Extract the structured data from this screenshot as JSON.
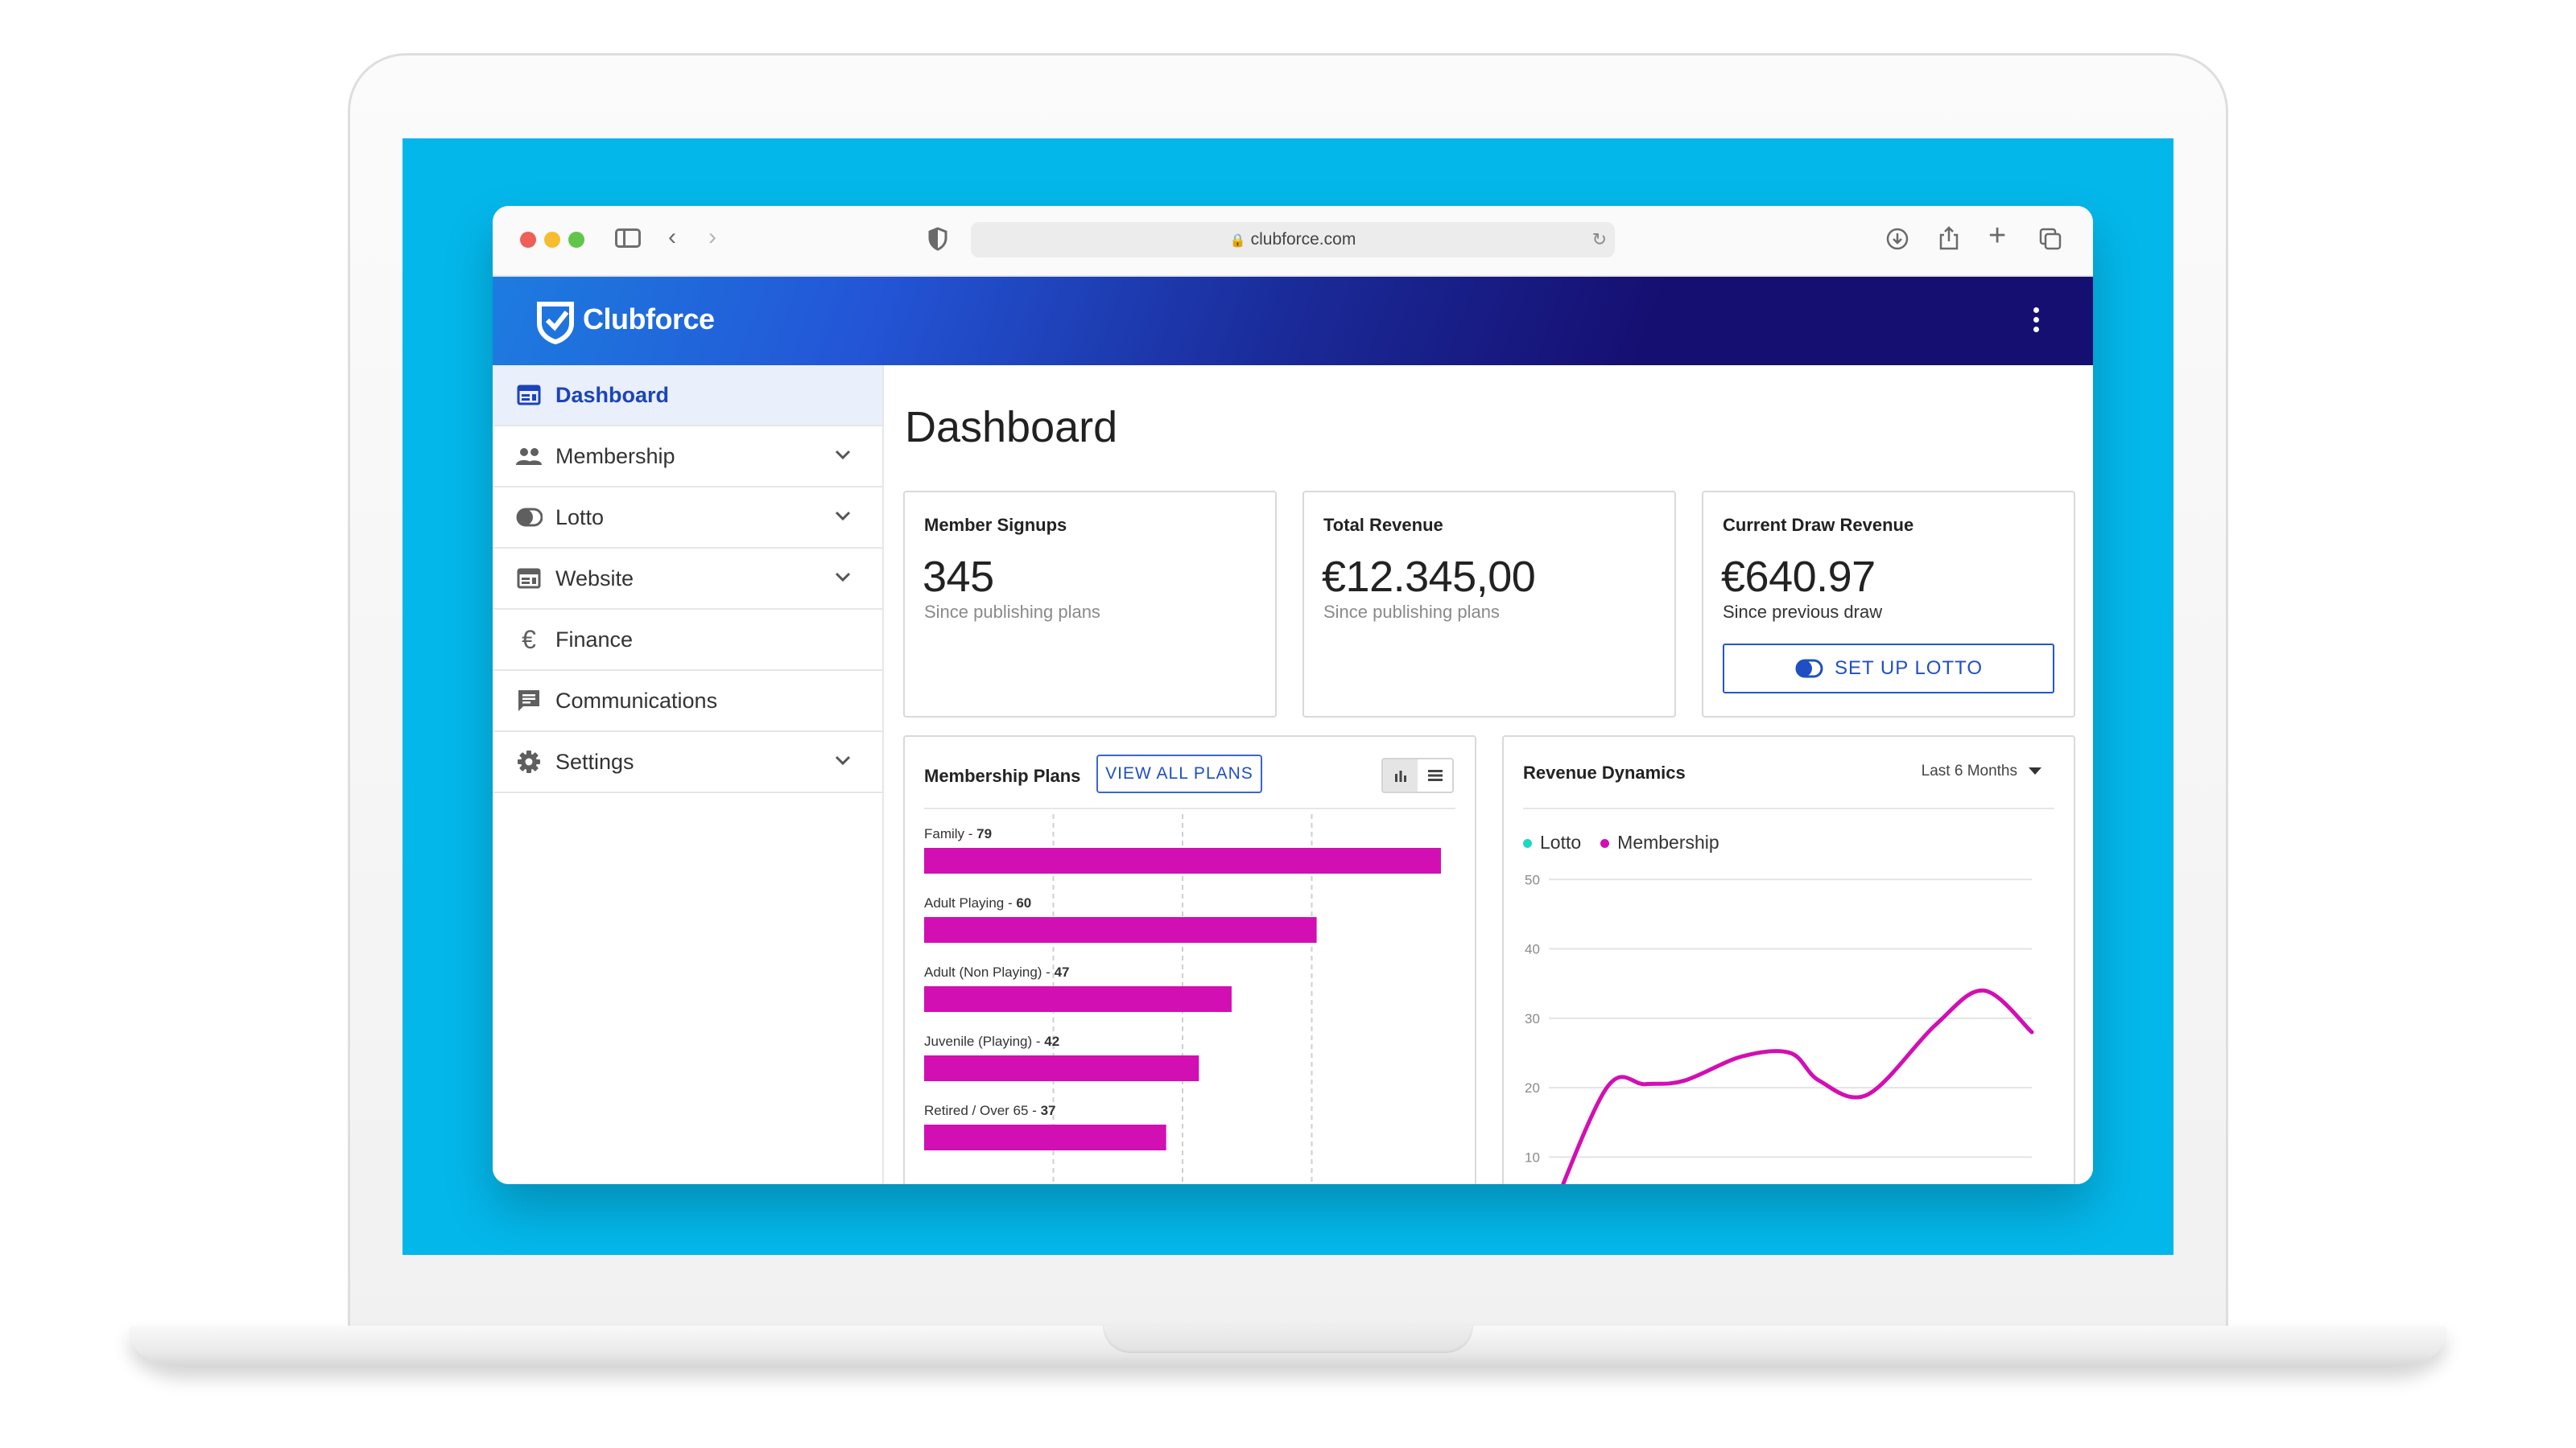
{
  "browser": {
    "url": "clubforce.com"
  },
  "app": {
    "brand": "Clubforce"
  },
  "sidebar": {
    "items": [
      {
        "label": "Dashboard",
        "icon": "dashboard-icon",
        "active": true,
        "expandable": false
      },
      {
        "label": "Membership",
        "icon": "people-icon",
        "active": false,
        "expandable": true
      },
      {
        "label": "Lotto",
        "icon": "toggle-icon",
        "active": false,
        "expandable": true
      },
      {
        "label": "Website",
        "icon": "web-icon",
        "active": false,
        "expandable": true
      },
      {
        "label": "Finance",
        "icon": "euro-icon",
        "active": false,
        "expandable": false
      },
      {
        "label": "Communications",
        "icon": "chat-icon",
        "active": false,
        "expandable": false
      },
      {
        "label": "Settings",
        "icon": "gear-icon",
        "active": false,
        "expandable": true
      }
    ]
  },
  "main": {
    "title": "Dashboard",
    "stats": [
      {
        "label": "Member Signups",
        "value": "345",
        "sub": "Since publishing plans"
      },
      {
        "label": "Total Revenue",
        "value": "€12.345,00",
        "sub": "Since publishing plans"
      },
      {
        "label": "Current Draw Revenue",
        "value": "€640.97",
        "sub": "Since previous draw",
        "button": "SET UP LOTTO"
      }
    ],
    "plans": {
      "title": "Membership Plans",
      "view_all": "VIEW ALL PLANS"
    },
    "revenue": {
      "title": "Revenue Dynamics",
      "range": "Last 6 Months"
    }
  },
  "colors": {
    "accent": "#1f4fc2",
    "bar": "#d20fb3",
    "lotto": "#1fd8c4",
    "membership": "#d20fb3",
    "backdrop": "#04b7ea"
  },
  "chart_data": [
    {
      "type": "bar",
      "orientation": "horizontal",
      "categories": [
        "Family",
        "Adult Playing",
        "Adult (Non Playing)",
        "Juvenile (Playing)",
        "Retired / Over 65"
      ],
      "values": [
        79,
        60,
        47,
        42,
        37
      ],
      "grid": true
    },
    {
      "type": "line",
      "series": [
        {
          "name": "Lotto",
          "values": []
        },
        {
          "name": "Membership",
          "x": [
            0,
            0.6,
            1,
            1.4,
            2,
            2.5,
            2.8,
            3.3,
            4,
            4.5,
            5
          ],
          "values": [
            1,
            20,
            20.5,
            21,
            24.5,
            25,
            21,
            19,
            29,
            34,
            28
          ]
        }
      ],
      "yticks": [
        10,
        20,
        30,
        40,
        50
      ],
      "ylim": [
        1,
        52
      ],
      "xlim": [
        0,
        5
      ],
      "legend": "top-left",
      "grid": true
    }
  ]
}
